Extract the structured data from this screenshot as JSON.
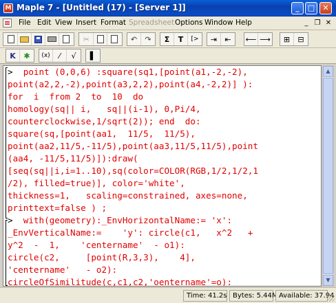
{
  "window": {
    "title": "Maple 7 - [Untitled (17) - [Server 1]]",
    "app_icon_glyph": "M",
    "controls": {
      "minimize": "_",
      "maximize": "□",
      "close": "✕"
    }
  },
  "menubar": {
    "items": [
      {
        "label": "File",
        "enabled": true
      },
      {
        "label": "Edit",
        "enabled": true
      },
      {
        "label": "View",
        "enabled": true
      },
      {
        "label": "Insert",
        "enabled": true
      },
      {
        "label": "Format",
        "enabled": true
      },
      {
        "label": "Spreadsheet",
        "enabled": false
      },
      {
        "label": "Options",
        "enabled": true
      },
      {
        "label": "Window",
        "enabled": true
      },
      {
        "label": "Help",
        "enabled": true
      }
    ],
    "mdi_controls": {
      "minimize": "_",
      "restore": "❐",
      "close": "✕"
    }
  },
  "toolbar": {
    "sigma_label": "Σ",
    "text_label": "T",
    "exec_label": "[>",
    "text_style": "Text",
    "icons": [
      "new-icon",
      "open-icon",
      "save-icon",
      "print-icon",
      "cut-icon",
      "copy-icon",
      "paste-icon",
      "undo-icon",
      "redo-icon",
      "sigma-icon",
      "text-icon",
      "exec-group-icon",
      "indent-icon",
      "outdent-icon",
      "back-arrow-icon",
      "forward-arrow-icon",
      "expand-icon",
      "collapse-icon"
    ]
  },
  "toolbar2": {
    "k_label": "K",
    "paren_label": "(x)",
    "frac_label": "√",
    "icons": [
      "k-icon",
      "bug-icon",
      "paren-icon",
      "fraction-icon",
      "sqrt-icon",
      "bar-icon"
    ]
  },
  "worksheet": {
    "prompt": ">",
    "lines": [
      "  point (0,0,6) :square(sq1,[point(a1,-2,-2),",
      "point(a2,2,-2),point(a3,2,2),point(a4,-2,2)] ):",
      "for  i  from 2  to  10  do",
      "homology(sq|| i,   sq||(i-1), 0,Pi/4,",
      "counterclockwise,1/sqrt(2)); end  do:",
      "square(sq,[point(aa1,  11/5,  11/5),",
      "point(aa2,11/5,-11/5),point(aa3,11/5,11/5),point",
      "(aa4, -11/5,11/5)]):draw(",
      "[seq(sq||i,i=1..10),sq(color=COLOR(RGB,1/2,1/2,1",
      "/2), filled=true)], color='white',",
      "thickness=1,   scaling=constrained, axes=none,",
      "printtext=false ) ;",
      "  with(geometry):_EnvHorizontalName:= 'x':",
      "_EnvVerticalName:=    'y': circle(c1,   x^2   +",
      "y^2  -  1,    'centername'  - o1):",
      "circle(c2,     [point(R,3,3),    4],",
      "'centername'   - o2):",
      "circleOfSimilitude(c,c1,c2,'oentername'=o):"
    ]
  },
  "statusbar": {
    "time": "Time: 41.2s",
    "bytes": "Bytes: 5.44M",
    "available": "Available: 37.94"
  },
  "colors": {
    "code": "#e00000",
    "titlebar": "#0a4cc7",
    "chrome": "#ece9d8"
  }
}
